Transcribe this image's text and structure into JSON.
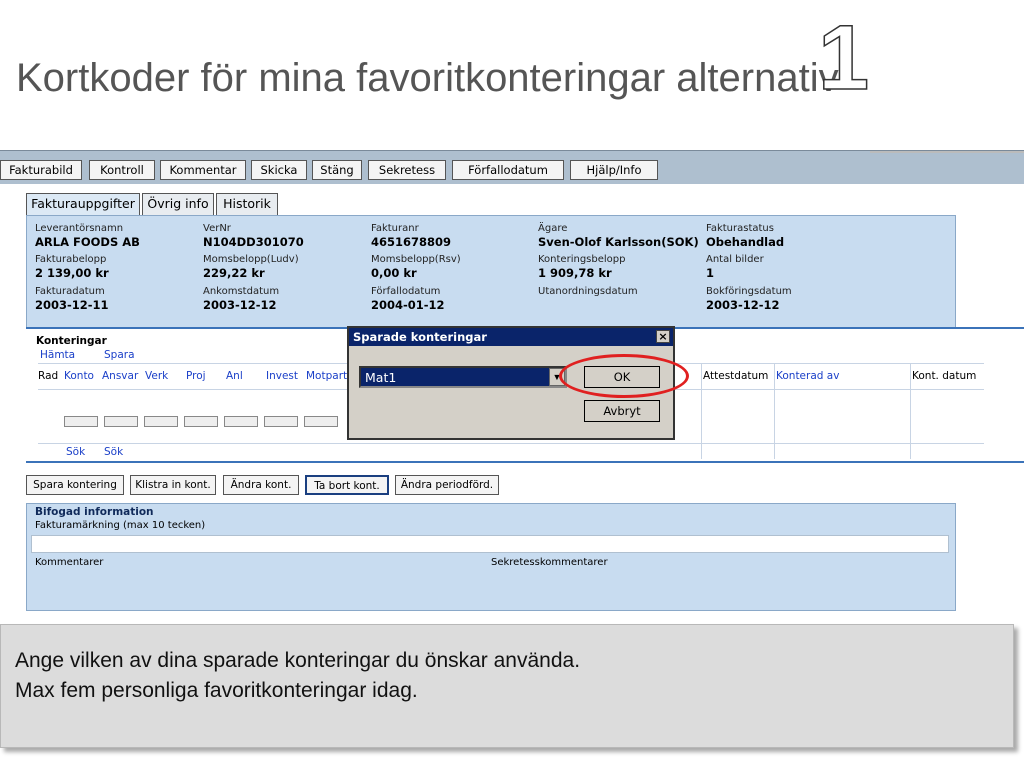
{
  "slide": {
    "title": "Kortkoder för mina favoritkonteringar alternativ",
    "number": "1"
  },
  "toolbar": {
    "buttons": [
      "Fakturabild",
      "Kontroll",
      "Kommentar",
      "Skicka",
      "Stäng",
      "Sekretess",
      "Förfallodatum",
      "Hjälp/Info"
    ]
  },
  "tabs": [
    "Fakturauppgifter",
    "Övrig info",
    "Historik"
  ],
  "invoice": {
    "leverantorsnamn_label": "Leverantörsnamn",
    "leverantorsnamn": "ARLA FOODS AB",
    "vernr_label": "VerNr",
    "vernr": "N104DD301070",
    "fakturanr_label": "Fakturanr",
    "fakturanr": "4651678809",
    "agare_label": "Ägare",
    "agare": "Sven-Olof Karlsson(SOK)",
    "fakturastatus_label": "Fakturastatus",
    "fakturastatus": "Obehandlad",
    "fakturabelopp_label": "Fakturabelopp",
    "fakturabelopp": "2 139,00 kr",
    "moms_ludv_label": "Momsbelopp(Ludv)",
    "moms_ludv": "229,22 kr",
    "moms_rsv_label": "Momsbelopp(Rsv)",
    "moms_rsv": "0,00 kr",
    "konteringsbelopp_label": "Konteringsbelopp",
    "konteringsbelopp": "1 909,78 kr",
    "antal_bilder_label": "Antal bilder",
    "antal_bilder": "1",
    "fakturadatum_label": "Fakturadatum",
    "fakturadatum": "2003-12-11",
    "ankomstdatum_label": "Ankomstdatum",
    "ankomstdatum": "2003-12-12",
    "forfallodatum_label": "Förfallodatum",
    "forfallodatum": "2004-01-12",
    "utanordningsdatum_label": "Utanordningsdatum",
    "bokforingsdatum_label": "Bokföringsdatum",
    "bokforingsdatum": "2003-12-12"
  },
  "konteringar": {
    "title": "Konteringar",
    "hamta": "Hämta",
    "spara": "Spara",
    "columns": {
      "rad": "Rad",
      "konto": "Konto",
      "ansvar": "Ansvar",
      "verk": "Verk",
      "proj": "Proj",
      "anl": "Anl",
      "invest": "Invest",
      "motpart": "Motpart",
      "attestdatum": "Attestdatum",
      "konterad_av": "Konterad av",
      "kont_datum": "Kont. datum"
    },
    "sok1": "Sök",
    "sok2": "Sök"
  },
  "actions": [
    "Spara kontering",
    "Klistra in kont.",
    "Ändra kont.",
    "Ta bort kont.",
    "Ändra periodförd."
  ],
  "bifogad": {
    "title": "Bifogad information",
    "fakturamarkning_label": "Fakturamärkning (max 10 tecken)",
    "kommentarer_label": "Kommentarer",
    "sekretess_label": "Sekretesskommentarer"
  },
  "dialog": {
    "title": "Sparade konteringar",
    "close": "×",
    "selected": "Mat1",
    "ok": "OK",
    "avbryt": "Avbryt",
    "highlight_color": "#e02020"
  },
  "caption": {
    "line1": "Ange vilken av dina sparade konteringar du önskar använda.",
    "line2": "Max fem personliga favoritkonteringar idag."
  }
}
